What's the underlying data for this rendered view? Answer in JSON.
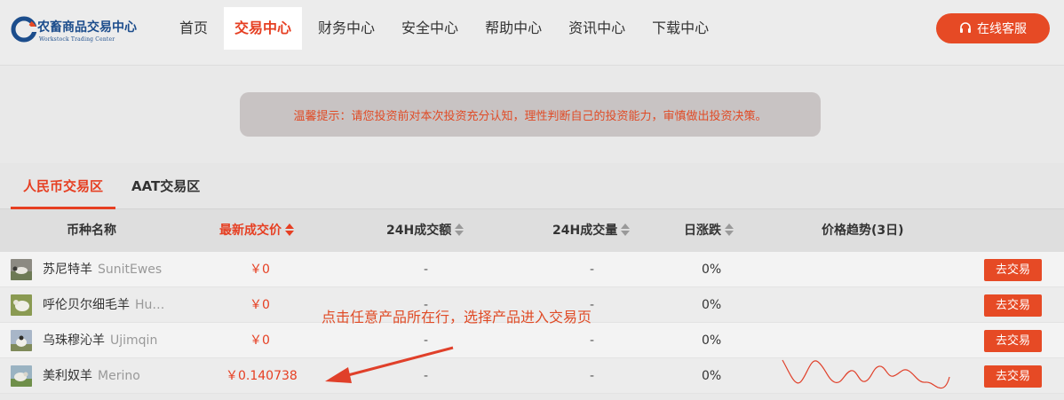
{
  "brand": {
    "name": "农畜商品交易中心",
    "subtitle": "Workstock Trading Center",
    "icon": "logo-c-mark"
  },
  "nav": {
    "items": [
      {
        "label": "首页",
        "active": false
      },
      {
        "label": "交易中心",
        "active": true
      },
      {
        "label": "财务中心",
        "active": false
      },
      {
        "label": "安全中心",
        "active": false
      },
      {
        "label": "帮助中心",
        "active": false
      },
      {
        "label": "资讯中心",
        "active": false
      },
      {
        "label": "下载中心",
        "active": false
      }
    ]
  },
  "service_button": {
    "label": "在线客服",
    "icon": "headset-icon"
  },
  "notice": {
    "text": "温馨提示：请您投资前对本次投资充分认知，理性判断自己的投资能力，审慎做出投资决策。"
  },
  "tabs": [
    {
      "label": "人民币交易区",
      "active": true
    },
    {
      "label": "AAT交易区",
      "active": false
    }
  ],
  "table": {
    "headers": {
      "name": "币种名称",
      "price": "最新成交价",
      "amount": "24H成交额",
      "volume": "24H成交量",
      "change": "日涨跌",
      "trend": "价格趋势(3日)"
    },
    "rows": [
      {
        "name": "苏尼特羊",
        "en": "SunitEwes",
        "price": "￥0",
        "amount": "-",
        "volume": "-",
        "change": "0%",
        "action": "去交易",
        "has_trend": false
      },
      {
        "name": "呼伦贝尔细毛羊",
        "en": "Hu…",
        "price": "￥0",
        "amount": "-",
        "volume": "-",
        "change": "0%",
        "action": "去交易",
        "has_trend": false
      },
      {
        "name": "乌珠穆沁羊",
        "en": "Ujimqin",
        "price": "￥0",
        "amount": "-",
        "volume": "-",
        "change": "0%",
        "action": "去交易",
        "has_trend": false
      },
      {
        "name": "美利奴羊",
        "en": "Merino",
        "price": "￥0.140738",
        "amount": "-",
        "volume": "-",
        "change": "0%",
        "action": "去交易",
        "has_trend": true
      }
    ]
  },
  "annotation": {
    "text": "点击任意产品所在行，选择产品进入交易页"
  },
  "colors": {
    "accent": "#e63f22",
    "button": "#e64a25",
    "brand_blue": "#1c4d8c"
  }
}
